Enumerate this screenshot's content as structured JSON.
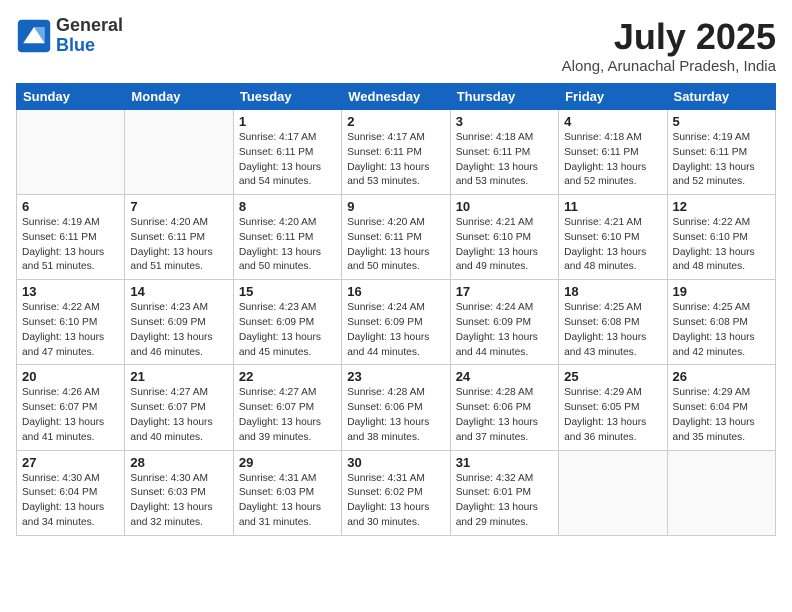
{
  "header": {
    "logo_general": "General",
    "logo_blue": "Blue",
    "month_year": "July 2025",
    "location": "Along, Arunachal Pradesh, India"
  },
  "weekdays": [
    "Sunday",
    "Monday",
    "Tuesday",
    "Wednesday",
    "Thursday",
    "Friday",
    "Saturday"
  ],
  "weeks": [
    [
      {
        "day": "",
        "info": ""
      },
      {
        "day": "",
        "info": ""
      },
      {
        "day": "1",
        "info": "Sunrise: 4:17 AM\nSunset: 6:11 PM\nDaylight: 13 hours and 54 minutes."
      },
      {
        "day": "2",
        "info": "Sunrise: 4:17 AM\nSunset: 6:11 PM\nDaylight: 13 hours and 53 minutes."
      },
      {
        "day": "3",
        "info": "Sunrise: 4:18 AM\nSunset: 6:11 PM\nDaylight: 13 hours and 53 minutes."
      },
      {
        "day": "4",
        "info": "Sunrise: 4:18 AM\nSunset: 6:11 PM\nDaylight: 13 hours and 52 minutes."
      },
      {
        "day": "5",
        "info": "Sunrise: 4:19 AM\nSunset: 6:11 PM\nDaylight: 13 hours and 52 minutes."
      }
    ],
    [
      {
        "day": "6",
        "info": "Sunrise: 4:19 AM\nSunset: 6:11 PM\nDaylight: 13 hours and 51 minutes."
      },
      {
        "day": "7",
        "info": "Sunrise: 4:20 AM\nSunset: 6:11 PM\nDaylight: 13 hours and 51 minutes."
      },
      {
        "day": "8",
        "info": "Sunrise: 4:20 AM\nSunset: 6:11 PM\nDaylight: 13 hours and 50 minutes."
      },
      {
        "day": "9",
        "info": "Sunrise: 4:20 AM\nSunset: 6:11 PM\nDaylight: 13 hours and 50 minutes."
      },
      {
        "day": "10",
        "info": "Sunrise: 4:21 AM\nSunset: 6:10 PM\nDaylight: 13 hours and 49 minutes."
      },
      {
        "day": "11",
        "info": "Sunrise: 4:21 AM\nSunset: 6:10 PM\nDaylight: 13 hours and 48 minutes."
      },
      {
        "day": "12",
        "info": "Sunrise: 4:22 AM\nSunset: 6:10 PM\nDaylight: 13 hours and 48 minutes."
      }
    ],
    [
      {
        "day": "13",
        "info": "Sunrise: 4:22 AM\nSunset: 6:10 PM\nDaylight: 13 hours and 47 minutes."
      },
      {
        "day": "14",
        "info": "Sunrise: 4:23 AM\nSunset: 6:09 PM\nDaylight: 13 hours and 46 minutes."
      },
      {
        "day": "15",
        "info": "Sunrise: 4:23 AM\nSunset: 6:09 PM\nDaylight: 13 hours and 45 minutes."
      },
      {
        "day": "16",
        "info": "Sunrise: 4:24 AM\nSunset: 6:09 PM\nDaylight: 13 hours and 44 minutes."
      },
      {
        "day": "17",
        "info": "Sunrise: 4:24 AM\nSunset: 6:09 PM\nDaylight: 13 hours and 44 minutes."
      },
      {
        "day": "18",
        "info": "Sunrise: 4:25 AM\nSunset: 6:08 PM\nDaylight: 13 hours and 43 minutes."
      },
      {
        "day": "19",
        "info": "Sunrise: 4:25 AM\nSunset: 6:08 PM\nDaylight: 13 hours and 42 minutes."
      }
    ],
    [
      {
        "day": "20",
        "info": "Sunrise: 4:26 AM\nSunset: 6:07 PM\nDaylight: 13 hours and 41 minutes."
      },
      {
        "day": "21",
        "info": "Sunrise: 4:27 AM\nSunset: 6:07 PM\nDaylight: 13 hours and 40 minutes."
      },
      {
        "day": "22",
        "info": "Sunrise: 4:27 AM\nSunset: 6:07 PM\nDaylight: 13 hours and 39 minutes."
      },
      {
        "day": "23",
        "info": "Sunrise: 4:28 AM\nSunset: 6:06 PM\nDaylight: 13 hours and 38 minutes."
      },
      {
        "day": "24",
        "info": "Sunrise: 4:28 AM\nSunset: 6:06 PM\nDaylight: 13 hours and 37 minutes."
      },
      {
        "day": "25",
        "info": "Sunrise: 4:29 AM\nSunset: 6:05 PM\nDaylight: 13 hours and 36 minutes."
      },
      {
        "day": "26",
        "info": "Sunrise: 4:29 AM\nSunset: 6:04 PM\nDaylight: 13 hours and 35 minutes."
      }
    ],
    [
      {
        "day": "27",
        "info": "Sunrise: 4:30 AM\nSunset: 6:04 PM\nDaylight: 13 hours and 34 minutes."
      },
      {
        "day": "28",
        "info": "Sunrise: 4:30 AM\nSunset: 6:03 PM\nDaylight: 13 hours and 32 minutes."
      },
      {
        "day": "29",
        "info": "Sunrise: 4:31 AM\nSunset: 6:03 PM\nDaylight: 13 hours and 31 minutes."
      },
      {
        "day": "30",
        "info": "Sunrise: 4:31 AM\nSunset: 6:02 PM\nDaylight: 13 hours and 30 minutes."
      },
      {
        "day": "31",
        "info": "Sunrise: 4:32 AM\nSunset: 6:01 PM\nDaylight: 13 hours and 29 minutes."
      },
      {
        "day": "",
        "info": ""
      },
      {
        "day": "",
        "info": ""
      }
    ]
  ]
}
